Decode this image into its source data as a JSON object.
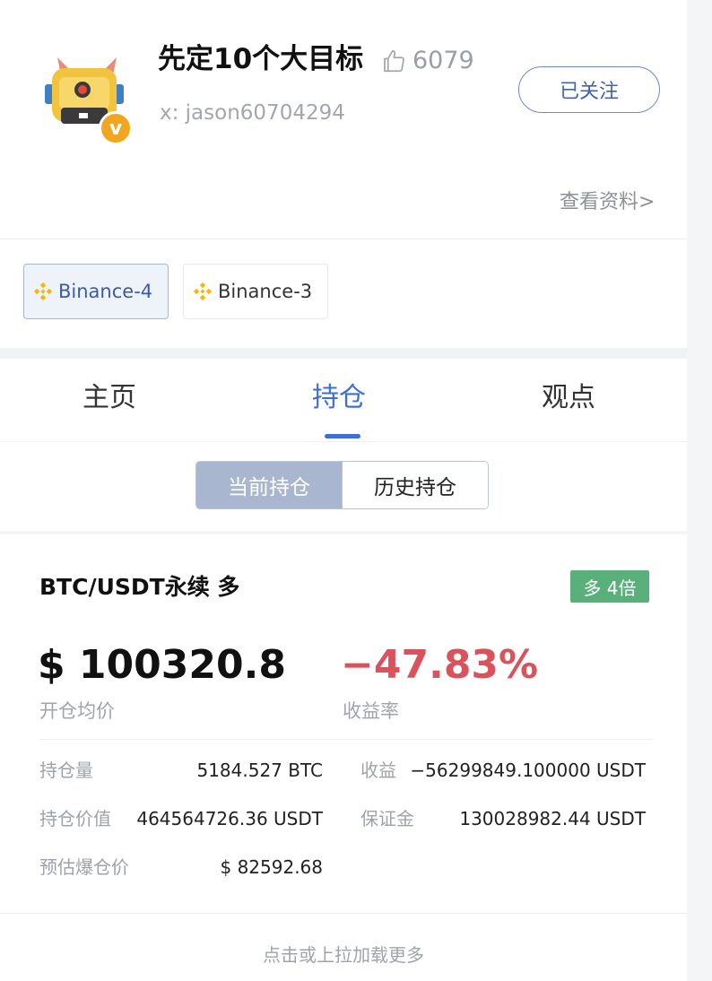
{
  "profile": {
    "nickname": "先定10个大目标",
    "likes": "6079",
    "user_id": "x: jason60704294",
    "follow_label": "已关注",
    "profile_link": "查看资料>",
    "avatar_badge": "v"
  },
  "exchanges": [
    {
      "label": "Binance-4",
      "active": true
    },
    {
      "label": "Binance-3",
      "active": false
    }
  ],
  "tabs": [
    {
      "label": "主页",
      "active": false
    },
    {
      "label": "持仓",
      "active": true
    },
    {
      "label": "观点",
      "active": false
    }
  ],
  "segment": {
    "current": "当前持仓",
    "history": "历史持仓"
  },
  "position": {
    "title": "BTC/USDT永续 多",
    "badge": "多 4倍",
    "avg_open_price": "$ 100320.8",
    "avg_open_price_label": "开仓均价",
    "roi": "−47.83%",
    "roi_label": "收益率",
    "details": {
      "size_label": "持仓量",
      "size_value": "5184.527 BTC",
      "pnl_label": "收益",
      "pnl_value": "−56299849.100000 USDT",
      "value_label": "持仓价值",
      "value_value": "464564726.36 USDT",
      "margin_label": "保证金",
      "margin_value": "130028982.44 USDT",
      "liq_label": "预估爆仓价",
      "liq_value": "$ 82592.68"
    }
  },
  "load_more": "点击或上拉加载更多",
  "colors": {
    "accent": "#3d6fd8",
    "negative": "#d9535d",
    "long_badge": "#5ab07a",
    "binance": "#f0b90b"
  },
  "icons": {
    "like": "thumbs-up-icon",
    "exchange": "binance-icon"
  }
}
